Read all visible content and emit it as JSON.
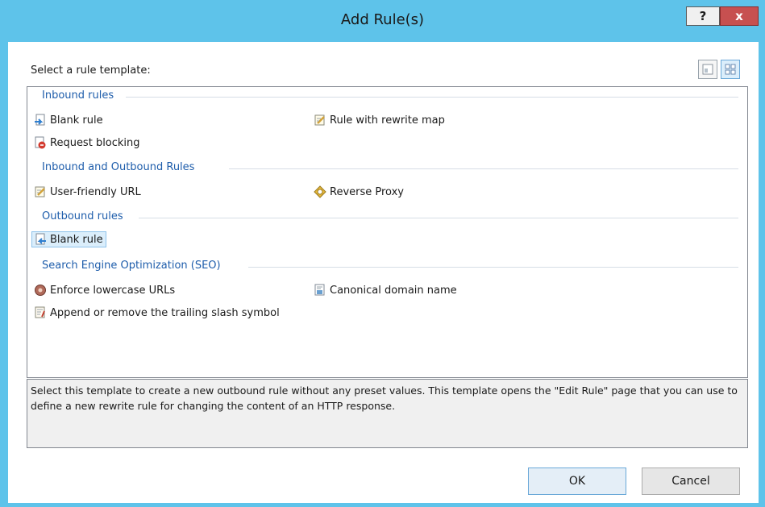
{
  "window": {
    "title": "Add Rule(s)",
    "help_label": "?",
    "close_label": "x",
    "accent_color": "#5ec3ea"
  },
  "prompt": "Select a rule template:",
  "groups": [
    {
      "header": "Inbound rules",
      "items": [
        {
          "label": "Blank rule",
          "icon": "inbound-blank-rule-icon"
        },
        {
          "label": "Rule with rewrite map",
          "icon": "rewrite-map-icon"
        },
        {
          "label": "Request blocking",
          "icon": "request-blocking-icon"
        }
      ]
    },
    {
      "header": "Inbound and Outbound Rules",
      "items": [
        {
          "label": "User-friendly URL",
          "icon": "user-friendly-url-icon"
        },
        {
          "label": "Reverse Proxy",
          "icon": "reverse-proxy-icon"
        }
      ]
    },
    {
      "header": "Outbound rules",
      "items": [
        {
          "label": "Blank rule",
          "icon": "outbound-blank-rule-icon",
          "selected": true
        }
      ]
    },
    {
      "header": "Search Engine Optimization (SEO)",
      "items": [
        {
          "label": "Enforce lowercase URLs",
          "icon": "lowercase-urls-icon"
        },
        {
          "label": "Canonical domain name",
          "icon": "canonical-domain-icon"
        },
        {
          "label": "Append or remove the trailing slash symbol",
          "icon": "trailing-slash-icon"
        }
      ]
    }
  ],
  "description": "Select this template to create a new outbound rule without any preset values. This template opens the \"Edit Rule\" page that you can use to define a new rewrite rule for changing the content of an HTTP response.",
  "buttons": {
    "ok": "OK",
    "cancel": "Cancel"
  }
}
